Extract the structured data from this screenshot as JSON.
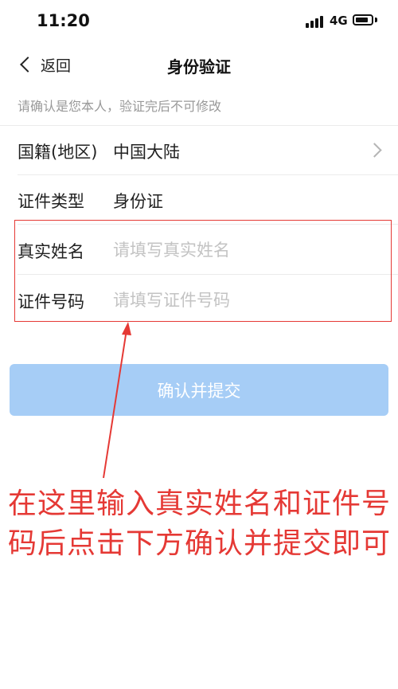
{
  "status_bar": {
    "time": "11:20",
    "network": "4G"
  },
  "nav": {
    "back_label": "返回",
    "title": "身份验证"
  },
  "notice": "请确认是您本人，验证完后不可修改",
  "form": {
    "nationality": {
      "label": "国籍(地区)",
      "value": "中国大陆"
    },
    "id_type": {
      "label": "证件类型",
      "value": "身份证"
    },
    "real_name": {
      "label": "真实姓名",
      "placeholder": "请填写真实姓名"
    },
    "id_number": {
      "label": "证件号码",
      "placeholder": "请填写证件号码"
    }
  },
  "submit_label": "确认并提交",
  "annotation": "在这里输入真实姓名和证件号码后点击下方确认并提交即可",
  "colors": {
    "accent_disabled": "#a6cdf6",
    "annotation_red": "#e53935"
  }
}
